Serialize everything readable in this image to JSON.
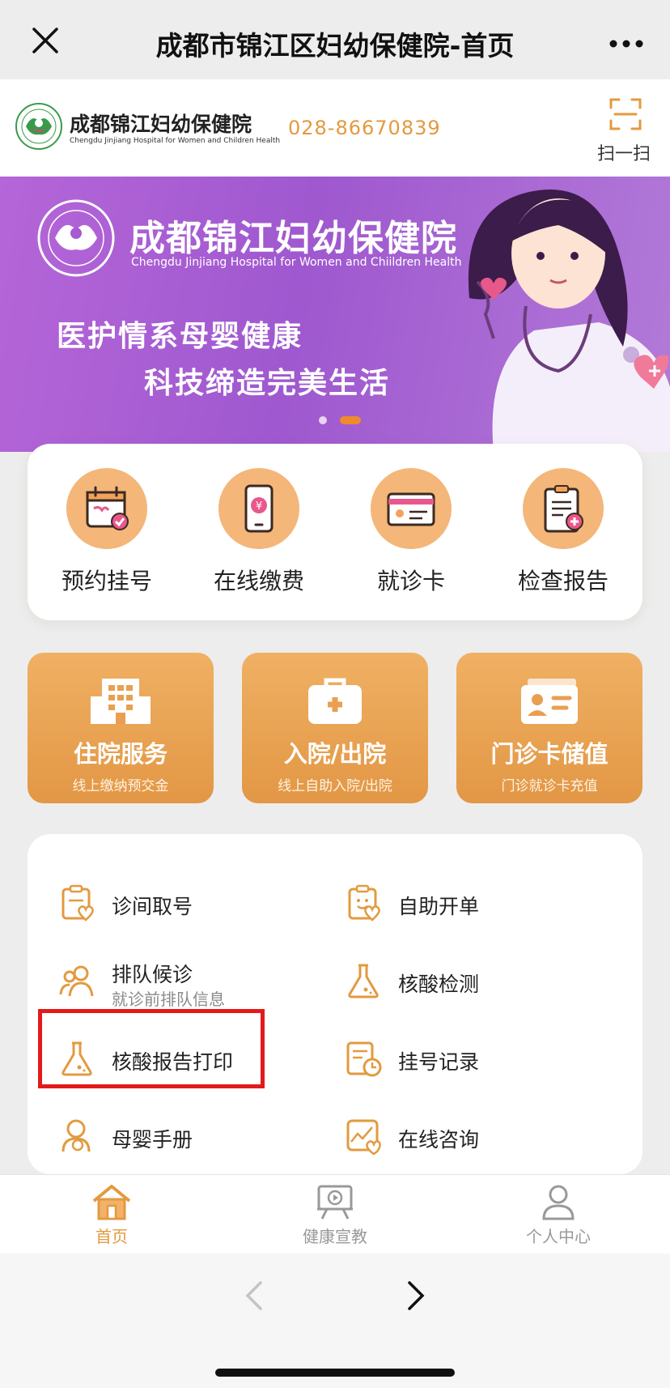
{
  "window": {
    "title": "成都市锦江区妇幼保健院-首页",
    "close_icon": "close-icon",
    "more_icon": "more-icon"
  },
  "header": {
    "hospital_name": "成都锦江妇幼保健院",
    "hospital_name_en": "Chengdu Jinjiang Hospital for Women and Children Health",
    "phone": "028-86670839",
    "scan_label": "扫一扫",
    "accent_color": "#e39a3f"
  },
  "banner": {
    "hospital_name": "成都锦江妇幼保健院",
    "hospital_name_en": "Chengdu Jinjiang Hospital for Women and Chiildren Health",
    "slogan_line1": "医护情系母婴健康",
    "slogan_line2": "科技缔造完美生活",
    "active_slide": 2,
    "slide_count": 2,
    "colors": {
      "bg": "#a65bd2",
      "dot_active": "#f08a2e"
    }
  },
  "quick_actions": [
    {
      "label": "预约挂号",
      "icon": "calendar-icon"
    },
    {
      "label": "在线缴费",
      "icon": "phone-payment-icon"
    },
    {
      "label": "就诊卡",
      "icon": "card-icon"
    },
    {
      "label": "检查报告",
      "icon": "report-icon"
    }
  ],
  "feature_cards": [
    {
      "title": "住院服务",
      "subtitle": "线上缴纳预交金",
      "icon": "building-icon"
    },
    {
      "title": "入院/出院",
      "subtitle": "线上自助入院/出院",
      "icon": "medical-kit-icon"
    },
    {
      "title": "门诊卡储值",
      "subtitle": "门诊就诊卡充值",
      "icon": "id-card-icon"
    }
  ],
  "services": [
    {
      "label": "诊间取号",
      "subtitle": "",
      "icon": "clipboard-heart-icon"
    },
    {
      "label": "自助开单",
      "subtitle": "",
      "icon": "clipboard-face-icon"
    },
    {
      "label": "排队候诊",
      "subtitle": "就诊前排队信息",
      "icon": "people-icon"
    },
    {
      "label": "核酸检测",
      "subtitle": "",
      "icon": "flask-icon"
    },
    {
      "label": "核酸报告打印",
      "subtitle": "",
      "icon": "flask-icon"
    },
    {
      "label": "挂号记录",
      "subtitle": "",
      "icon": "record-clock-icon"
    },
    {
      "label": "母婴手册",
      "subtitle": "",
      "icon": "mother-baby-icon"
    },
    {
      "label": "在线咨询",
      "subtitle": "",
      "icon": "chart-heart-icon"
    }
  ],
  "tabbar": [
    {
      "label": "首页",
      "icon": "home-icon",
      "active": true
    },
    {
      "label": "健康宣教",
      "icon": "video-board-icon",
      "active": false
    },
    {
      "label": "个人中心",
      "icon": "user-icon",
      "active": false
    }
  ],
  "colors": {
    "icon_orange": "#e39a3f",
    "highlight_red": "#e41a1a",
    "tab_active": "#e39a3f",
    "tab_inactive": "#999999"
  }
}
